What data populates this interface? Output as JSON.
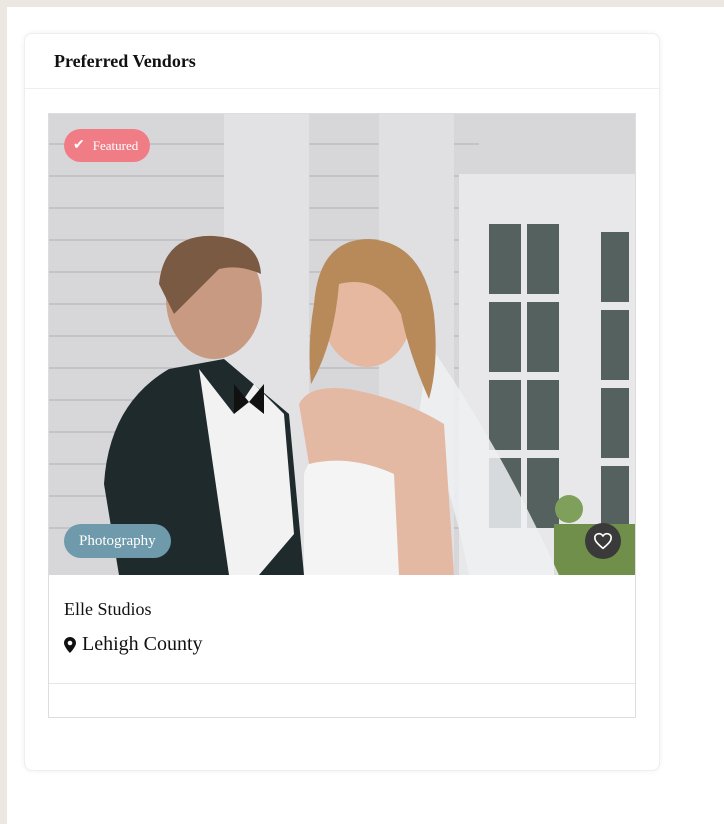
{
  "widget": {
    "title": "Preferred Vendors"
  },
  "vendor": {
    "featured_label": "Featured",
    "category": "Photography",
    "name": "Elle Studios",
    "location": "Lehigh County",
    "icons": {
      "featured": "check-icon",
      "favorite": "heart-icon",
      "location": "map-pin-icon"
    }
  },
  "colors": {
    "featured_badge": "#f07d86",
    "category_badge": "#6e9aac",
    "favorite_button": "#3a3a3a",
    "page_border": "#ece8e1"
  }
}
